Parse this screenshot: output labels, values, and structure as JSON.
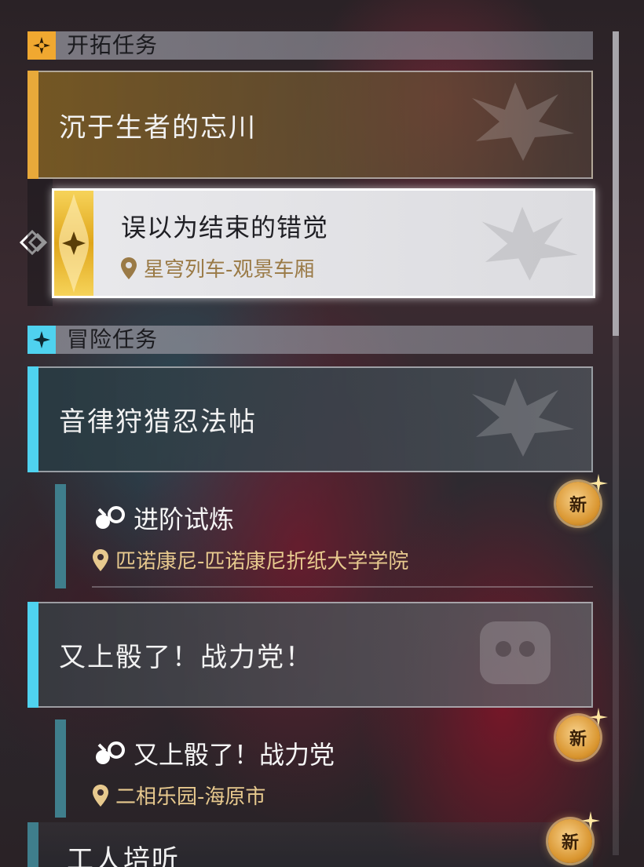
{
  "sections": [
    {
      "header": "开拓任务",
      "icon": "trailblaze-star-icon",
      "accent": "#e8a93a",
      "quest": "沉于生者的忘川",
      "sub": {
        "title": "误以为结束的错觉",
        "location": "星穹列车-观景车厢",
        "selected": true
      }
    },
    {
      "header": "冒险任务",
      "icon": "adventure-star-icon",
      "accent": "#4fd2ef",
      "quests": [
        {
          "title": "音律狩猎忍法帖",
          "sub": {
            "title": "进阶试炼",
            "location": "匹诺康尼-匹诺康尼折纸大学学院",
            "badge": "新"
          }
        },
        {
          "title": "又上骰了！战力党！",
          "sub": {
            "title": "又上骰了！战力党",
            "location": "二相乐园-海原市",
            "badge": "新"
          }
        },
        {
          "title": "工人培听",
          "badge": "新"
        }
      ]
    }
  ],
  "colors": {
    "gold": "#e7c98e",
    "teal": "#3f7e8c",
    "cyan": "#4fd2ef",
    "amber": "#e8a93a"
  }
}
